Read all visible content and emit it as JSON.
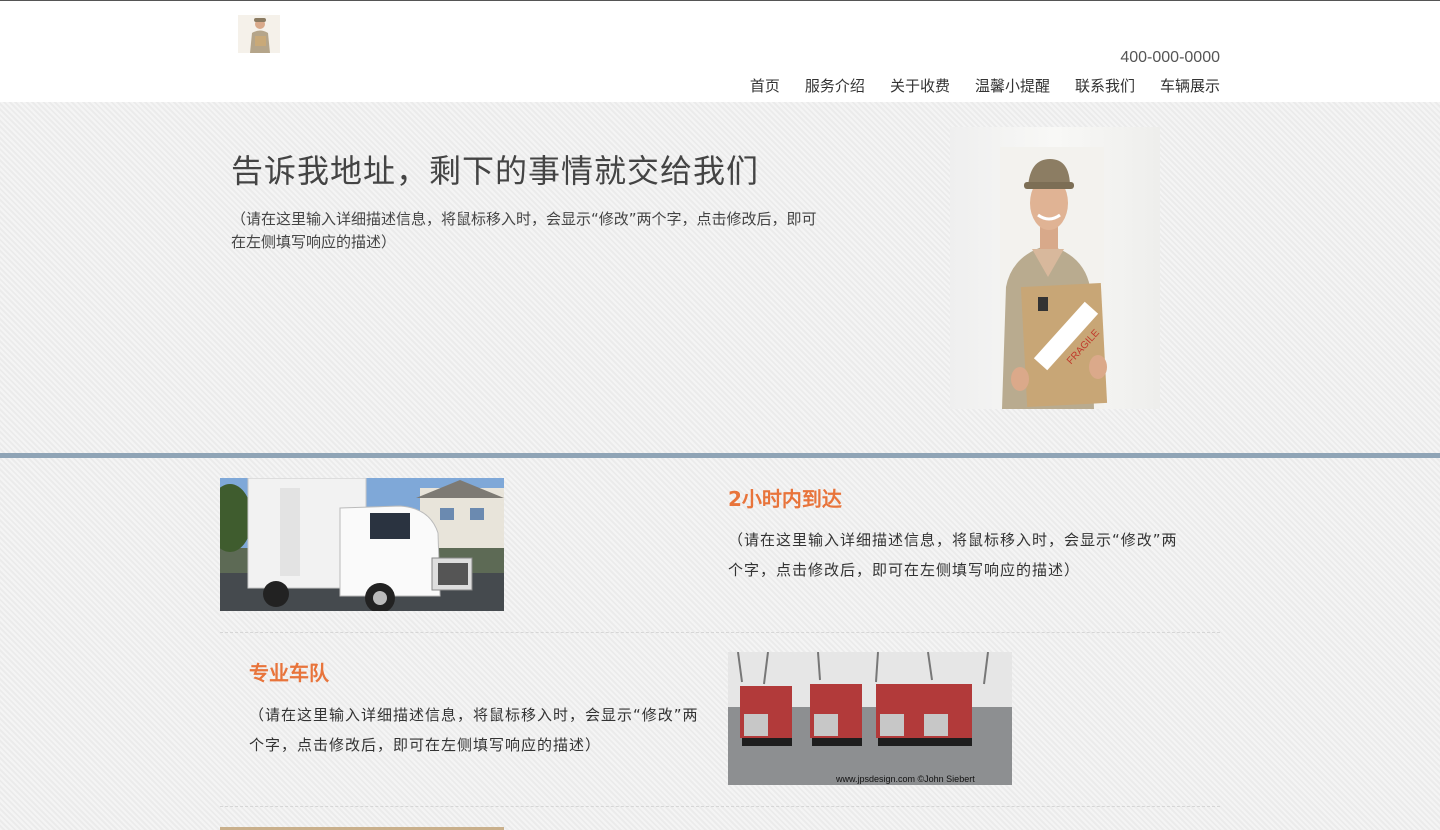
{
  "header": {
    "phone": "400-000-0000",
    "nav": [
      "首页",
      "服务介绍",
      "关于收费",
      "温馨小提醒",
      "联系我们",
      "车辆展示"
    ]
  },
  "hero": {
    "title": "告诉我地址，剩下的事情就交给我们",
    "description": "（请在这里输入详细描述信息，将鼠标移入时，会显示“修改”两个字，点击修改后，即可在左侧填写响应的描述）"
  },
  "features": [
    {
      "title": "2小时内到达",
      "description": "（请在这里输入详细描述信息，将鼠标移入时，会显示“修改”两个字，点击修改后，即可在左侧填写响应的描述）"
    },
    {
      "title": "专业车队",
      "description": "（请在这里输入详细描述信息，将鼠标移入时，会显示“修改”两个字，点击修改后，即可在左侧填写响应的描述）",
      "image_caption": "www.jpsdesign.com ©John Siebert"
    }
  ],
  "colors": {
    "accent": "#e8743b",
    "divider": "#8fa4b6"
  }
}
